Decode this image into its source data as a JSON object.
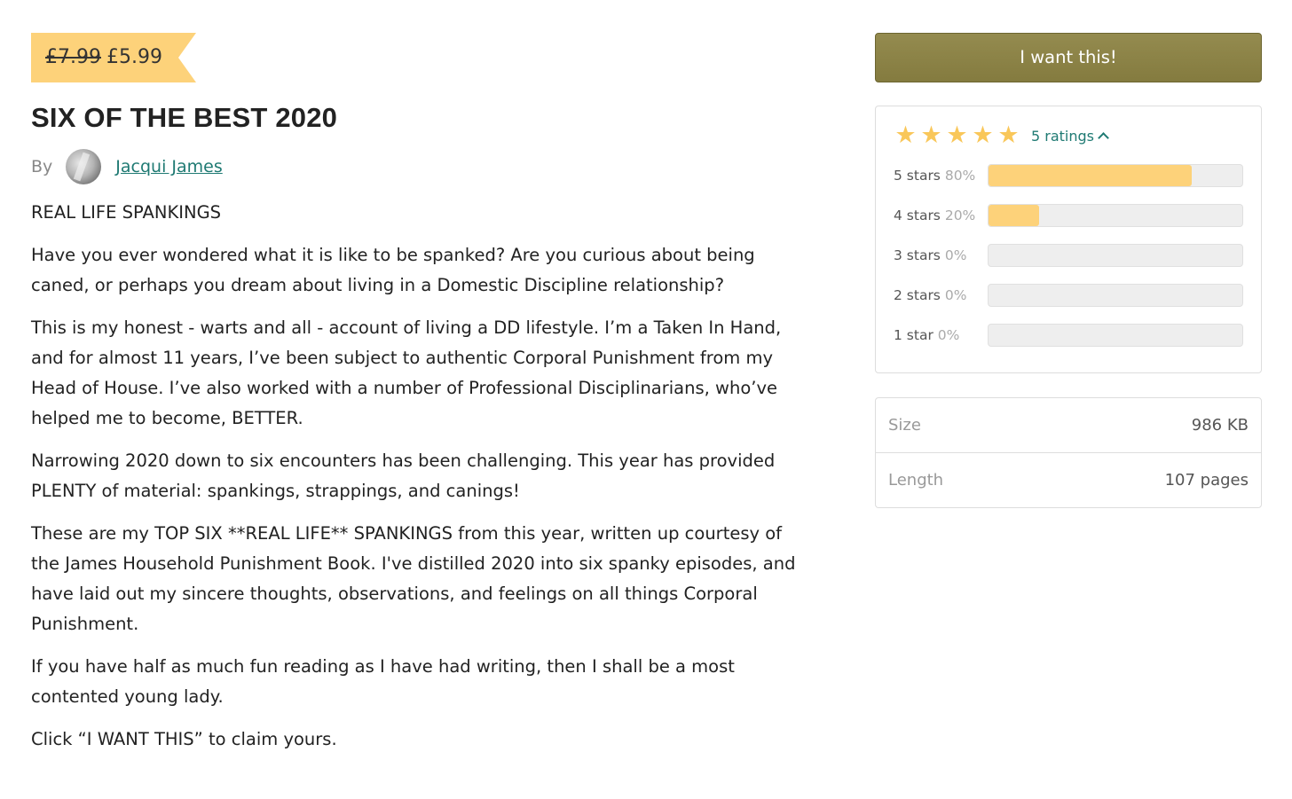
{
  "product": {
    "price_old": "£7.99",
    "price_new": "£5.99",
    "title": "SIX OF THE BEST 2020",
    "by_label": "By",
    "author": "Jacqui James"
  },
  "description": [
    "REAL LIFE SPANKINGS",
    "Have you ever wondered what it is like to be spanked? Are you curious about being caned, or perhaps you dream about living in a Domestic Discipline relationship?",
    "This is my honest - warts and all - account of living a DD lifestyle. I’m a Taken In Hand, and for almost 11 years, I’ve been subject to authentic Corporal Punishment from my Head of House. I’ve also worked with a number of Professional Disciplinarians, who’ve helped me to become, BETTER.",
    "Narrowing 2020 down to six encounters has been challenging. This year has provided PLENTY of material: spankings, strappings, and canings!",
    "These are my TOP SIX **REAL LIFE** SPANKINGS from this year, written up courtesy of the James Household Punishment Book. I've distilled 2020 into six spanky episodes, and have laid out my sincere thoughts, observations, and feelings on all things Corporal Punishment.",
    "If you have half as much fun reading as I have had writing, then I shall be a most contented young lady.",
    "Click “I WANT THIS” to claim yours."
  ],
  "sidebar": {
    "buy_button": "I want this!",
    "ratings_toggle": "5 ratings",
    "star_icon": "★",
    "rating_stars": 5,
    "star_color": "#f9c75a",
    "bar_color": "#fdd27a",
    "button_color": "#8b8247",
    "link_color": "#1f7a73",
    "distribution": [
      {
        "label": "5 stars",
        "pct": "80%",
        "value": 0.8
      },
      {
        "label": "4 stars",
        "pct": "20%",
        "value": 0.2
      },
      {
        "label": "3 stars",
        "pct": "0%",
        "value": 0
      },
      {
        "label": "2 stars",
        "pct": "0%",
        "value": 0
      },
      {
        "label": "1 star",
        "pct": "0%",
        "value": 0
      }
    ],
    "details": [
      {
        "key": "Size",
        "value": "986 KB"
      },
      {
        "key": "Length",
        "value": "107 pages"
      }
    ]
  }
}
